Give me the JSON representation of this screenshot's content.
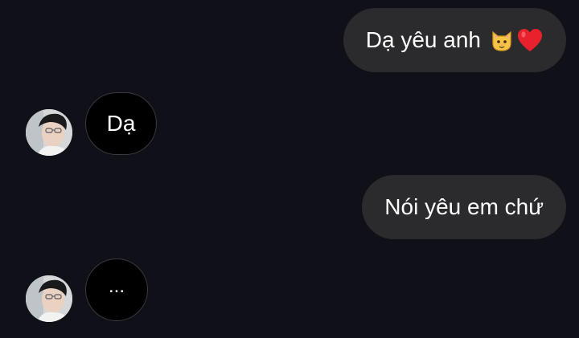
{
  "messages": [
    {
      "direction": "outgoing",
      "text": "Dạ yêu anh",
      "emoji": [
        "cat-face-icon",
        "red-heart-icon"
      ]
    },
    {
      "direction": "incoming",
      "text": "Dạ",
      "avatar": "profile-photo"
    },
    {
      "direction": "outgoing",
      "text": "Nói yêu em chứ"
    },
    {
      "direction": "incoming",
      "text": "...",
      "avatar": "profile-photo"
    }
  ],
  "colors": {
    "background": "#101018",
    "outgoing_bubble": "#2b2b2e",
    "incoming_bubble": "#000000",
    "incoming_border": "#3a3a3f",
    "text": "#ffffff"
  }
}
